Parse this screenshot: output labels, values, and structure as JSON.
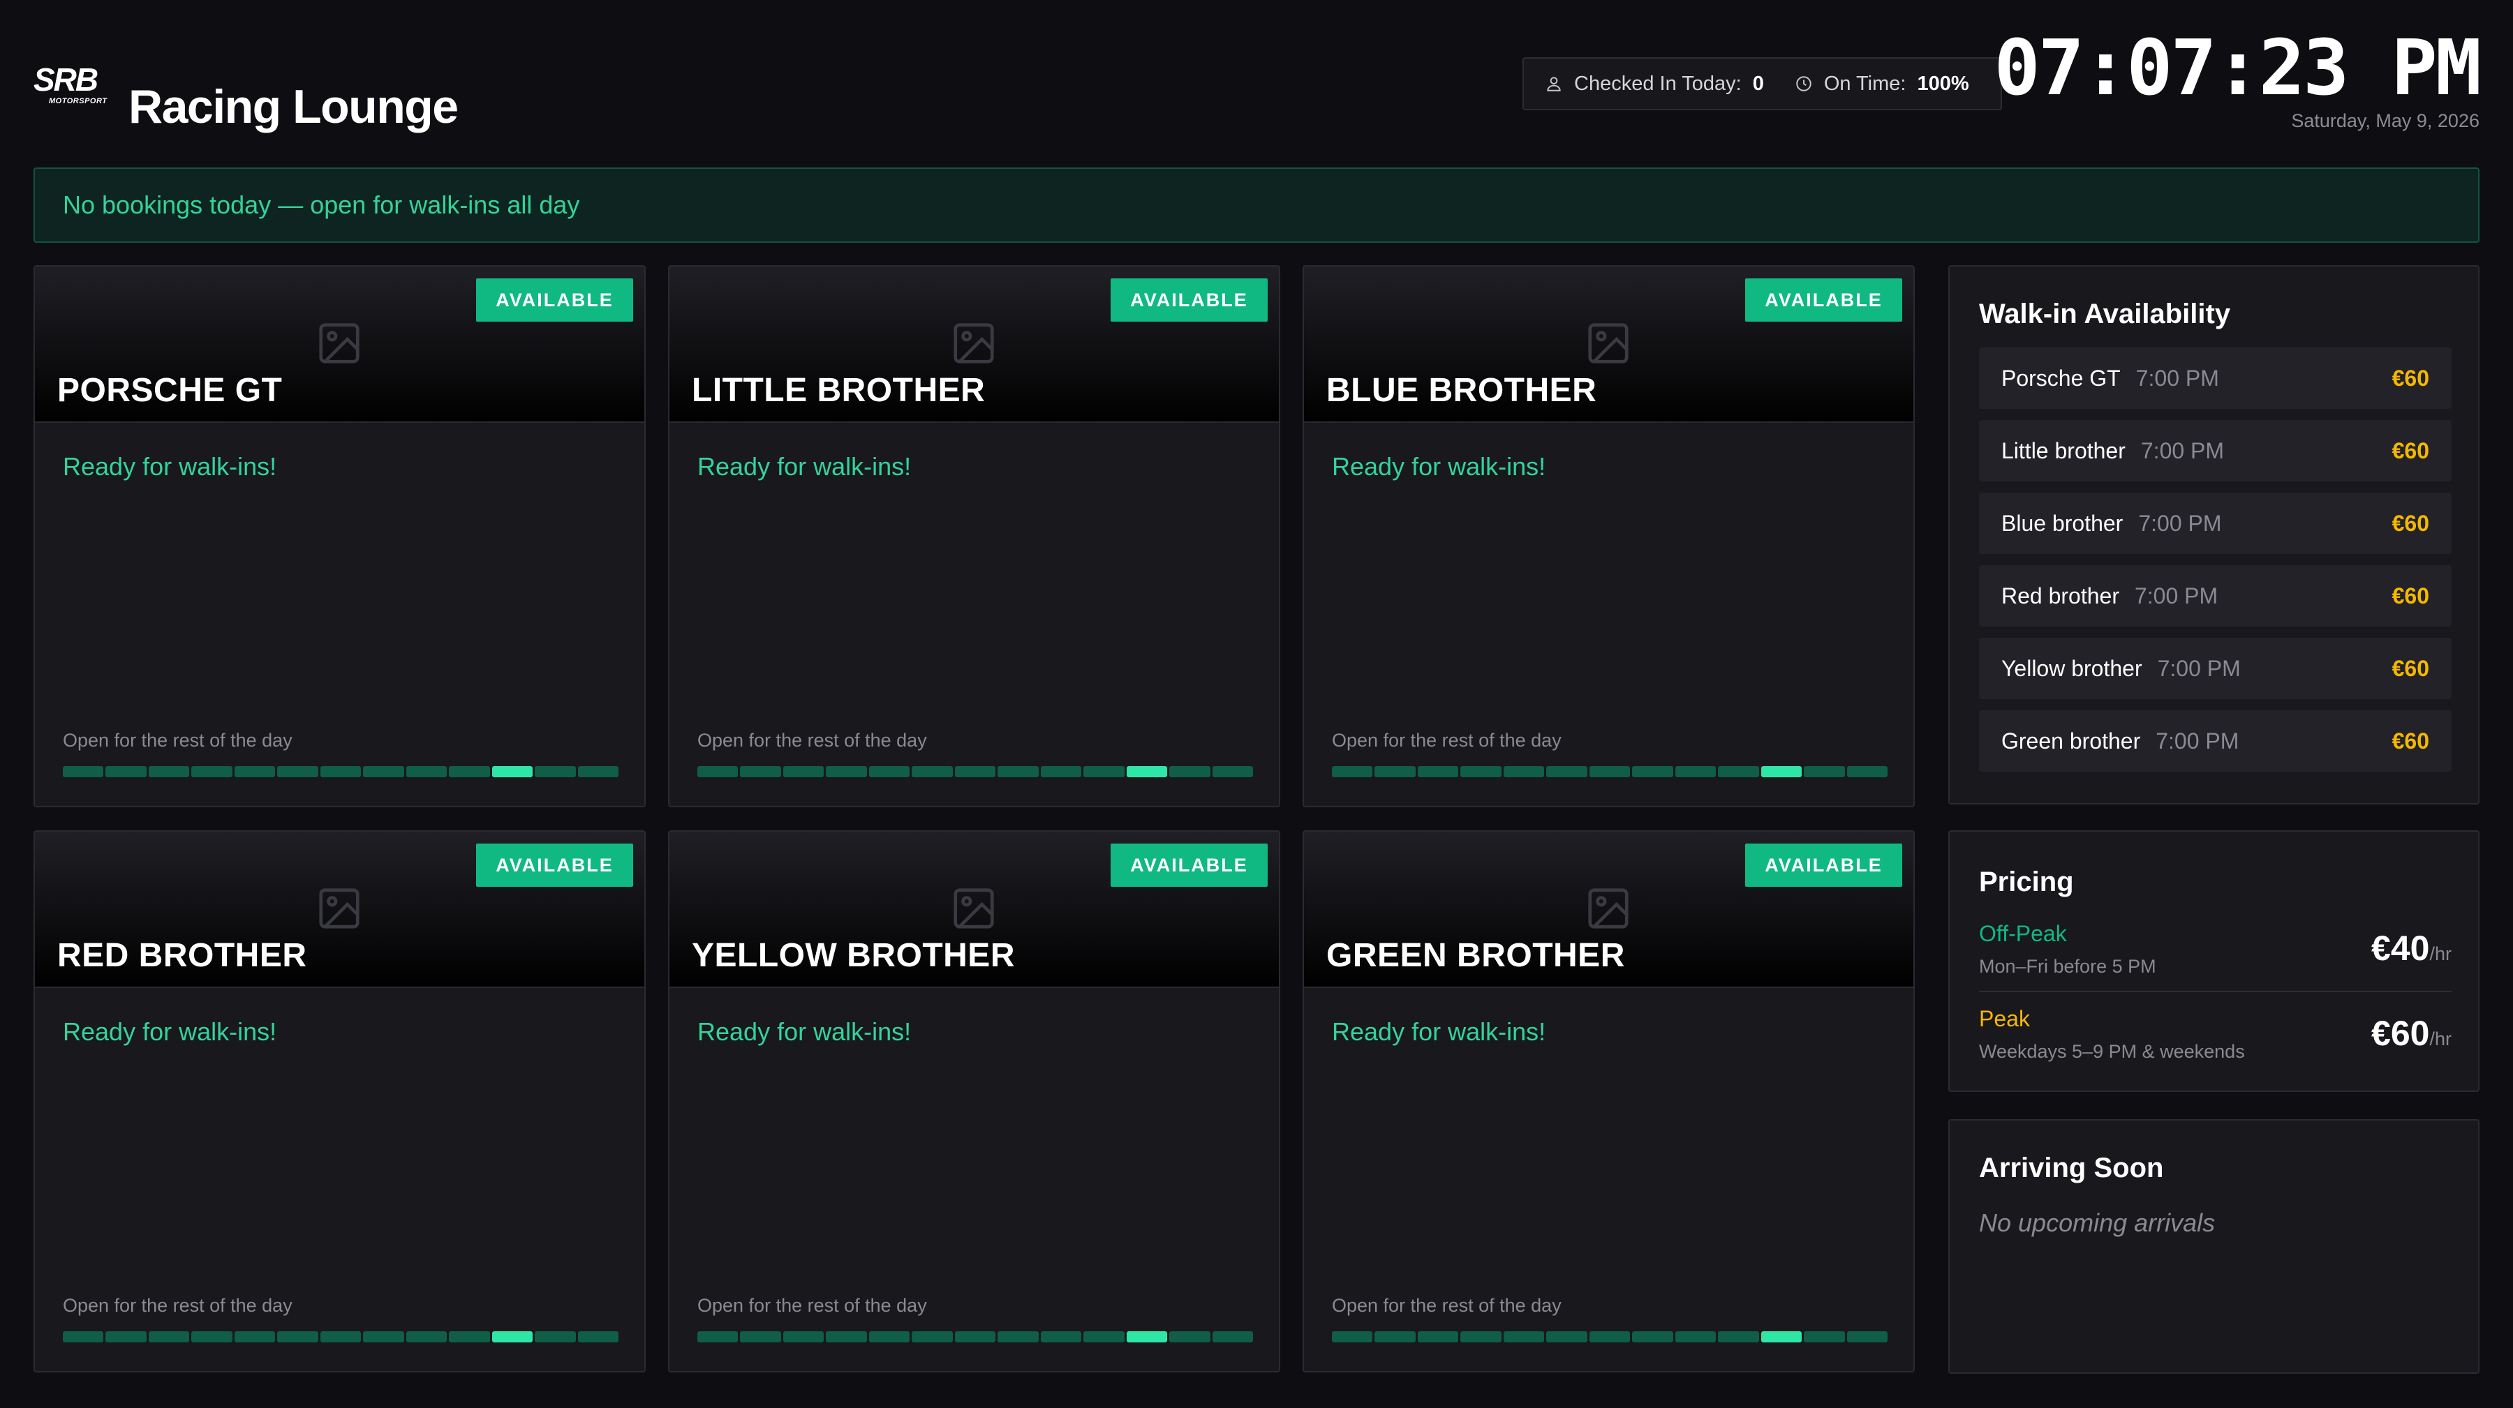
{
  "header": {
    "logo_text": "SRB MOTORSPORT",
    "title": "Racing Lounge",
    "stats": {
      "checked_in_label": "Checked In Today:",
      "checked_in_value": "0",
      "on_time_label": "On Time:",
      "on_time_value": "100%"
    },
    "clock": "07:07:23 PM",
    "date": "Saturday, May 9, 2026"
  },
  "banner": {
    "text": "No bookings today — open for walk-ins all day"
  },
  "cars": [
    {
      "name": "PORSCHE GT",
      "status": "AVAILABLE",
      "message": "Ready for walk-ins!",
      "availability_text": "Open for the rest of the day"
    },
    {
      "name": "LITTLE BROTHER",
      "status": "AVAILABLE",
      "message": "Ready for walk-ins!",
      "availability_text": "Open for the rest of the day"
    },
    {
      "name": "BLUE BROTHER",
      "status": "AVAILABLE",
      "message": "Ready for walk-ins!",
      "availability_text": "Open for the rest of the day"
    },
    {
      "name": "RED BROTHER",
      "status": "AVAILABLE",
      "message": "Ready for walk-ins!",
      "availability_text": "Open for the rest of the day"
    },
    {
      "name": "YELLOW BROTHER",
      "status": "AVAILABLE",
      "message": "Ready for walk-ins!",
      "availability_text": "Open for the rest of the day"
    },
    {
      "name": "GREEN BROTHER",
      "status": "AVAILABLE",
      "message": "Ready for walk-ins!",
      "availability_text": "Open for the rest of the day"
    }
  ],
  "timeline": {
    "segment_count": 13,
    "current_segment_index": 10
  },
  "walkin": {
    "title": "Walk-in Availability",
    "items": [
      {
        "name": "Porsche GT",
        "time": "7:00 PM",
        "price": "€60"
      },
      {
        "name": "Little brother",
        "time": "7:00 PM",
        "price": "€60"
      },
      {
        "name": "Blue brother",
        "time": "7:00 PM",
        "price": "€60"
      },
      {
        "name": "Red brother",
        "time": "7:00 PM",
        "price": "€60"
      },
      {
        "name": "Yellow brother",
        "time": "7:00 PM",
        "price": "€60"
      },
      {
        "name": "Green brother",
        "time": "7:00 PM",
        "price": "€60"
      }
    ]
  },
  "pricing": {
    "title": "Pricing",
    "offpeak": {
      "label": "Off-Peak",
      "desc": "Mon–Fri before 5 PM",
      "amount": "€40",
      "unit": "/hr"
    },
    "peak": {
      "label": "Peak",
      "desc": "Weekdays 5–9 PM & weekends",
      "amount": "€60",
      "unit": "/hr"
    }
  },
  "arriving": {
    "title": "Arriving Soon",
    "empty_text": "No upcoming arrivals"
  },
  "colors": {
    "background": "#0e0e12",
    "accent_green": "#10b981",
    "text_green": "#34d399",
    "offpeak_green": "#10b981",
    "peak_yellow": "#f5b800",
    "price_gold": "#f5b800"
  },
  "icons": {
    "checked_in": "person-icon",
    "on_time": "clock-icon",
    "car_image_placeholder": "image-placeholder-icon"
  }
}
